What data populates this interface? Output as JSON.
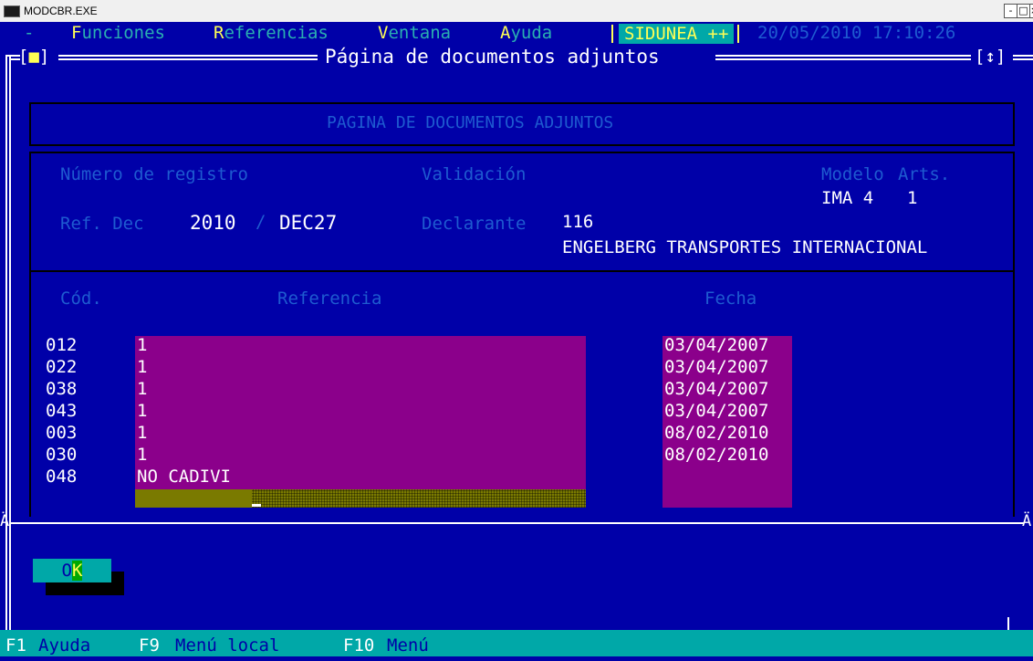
{
  "window": {
    "title": "MODCBR.EXE",
    "minimize": "-",
    "maximize": "□",
    "close": "×"
  },
  "menu": {
    "dash": "-",
    "items": [
      {
        "first": "F",
        "rest": "unciones"
      },
      {
        "first": "R",
        "rest": "eferencias"
      },
      {
        "first": "V",
        "rest": "entana"
      },
      {
        "first": "A",
        "rest": "yuda"
      }
    ],
    "app": "SIDUNEA ++",
    "datetime": "20/05/2010 17:10:26"
  },
  "frame": {
    "title": "Página de documentos adjuntos",
    "left_marker": "[",
    "left_block": "■",
    "left_marker_end": "]",
    "right_marker": "[↕]"
  },
  "page": {
    "heading": "PAGINA DE DOCUMENTOS ADJUNTOS",
    "labels": {
      "registro": "Número de registro",
      "validacion": "Validación",
      "modelo": "Modelo",
      "arts": "Arts.",
      "ref_dec": "Ref. Dec",
      "declarante": "Declarante"
    },
    "values": {
      "modelo": "IMA 4",
      "arts": "1",
      "year": "2010",
      "slash": "/",
      "dec": "DEC27",
      "declarante_code": "116",
      "declarante_name": "ENGELBERG TRANSPORTES INTERNACIONAL"
    },
    "columns": {
      "cod": "Cód.",
      "ref": "Referencia",
      "fecha": "Fecha"
    },
    "rows": [
      {
        "cod": "012",
        "ref": "1",
        "fecha": "03/04/2007"
      },
      {
        "cod": "022",
        "ref": "1",
        "fecha": "03/04/2007"
      },
      {
        "cod": "038",
        "ref": "1",
        "fecha": "03/04/2007"
      },
      {
        "cod": "043",
        "ref": "1",
        "fecha": "03/04/2007"
      },
      {
        "cod": "003",
        "ref": "1",
        "fecha": "08/02/2010"
      },
      {
        "cod": "030",
        "ref": "1",
        "fecha": "08/02/2010"
      },
      {
        "cod": "048",
        "ref": "NO CADIVI",
        "fecha": ""
      }
    ],
    "separator_glyph": "Ä"
  },
  "ok_button": {
    "first": "O",
    "hotkey": "K"
  },
  "status": {
    "k1": "F1",
    "t1": "Ayuda",
    "k2": "F9",
    "t2": "Menú local",
    "k3": "F10",
    "t3": "Menú"
  },
  "colors": {
    "background": "#0000a8",
    "field": "#8b008b",
    "active_field": "#7a7a00",
    "highlight": "#ffff55",
    "teal": "#00a8a8"
  }
}
